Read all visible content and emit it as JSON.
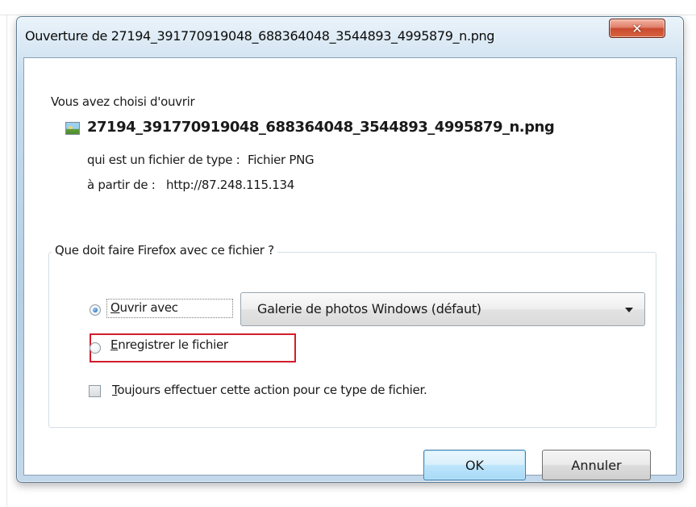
{
  "window": {
    "title": "Ouverture de 27194_391770919048_688364048_3544893_4995879_n.png",
    "close_glyph": "✕"
  },
  "dialog": {
    "intro": "Vous avez choisi d'ouvrir",
    "file_icon": "png-image-icon",
    "file_name": "27194_391770919048_688364048_3544893_4995879_n.png",
    "type_label": "qui est un fichier de type :",
    "type_value": "Fichier PNG",
    "source_label": "à partir de :",
    "source_value": "http://87.248.115.134",
    "group_title": "Que doit faire Firefox avec ce fichier ?",
    "open_with": {
      "label_underlined": "O",
      "label_rest": "uvrir avec",
      "checked": true
    },
    "app_select": {
      "value": "Galerie de photos Windows (défaut)"
    },
    "save_file": {
      "label_underlined": "E",
      "label_rest": "nregistrer le fichier",
      "checked": false,
      "highlight_color": "#d21e2a"
    },
    "always": {
      "label_underlined": "T",
      "label_rest": "oujours effectuer cette action pour ce type de fichier.",
      "checked": false
    }
  },
  "buttons": {
    "ok": "OK",
    "cancel": "Annuler"
  }
}
